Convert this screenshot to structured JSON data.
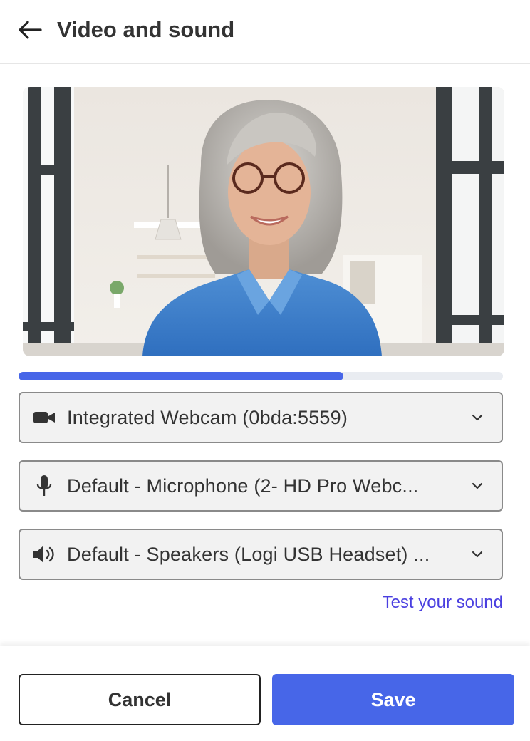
{
  "header": {
    "title": "Video and sound",
    "back_icon": "arrow-left-icon"
  },
  "preview": {
    "description_icon": "camera-preview"
  },
  "audio_level": {
    "fraction": 0.67,
    "color": "#4766e8"
  },
  "devices": {
    "camera": {
      "icon": "video-camera-icon",
      "selected": "Integrated Webcam (0bda:5559)"
    },
    "microphone": {
      "icon": "microphone-icon",
      "selected": "Default - Microphone (2- HD Pro Webc..."
    },
    "speaker": {
      "icon": "speaker-icon",
      "selected": "Default - Speakers (Logi USB Headset) ..."
    }
  },
  "test_sound_label": "Test your sound",
  "footer": {
    "cancel_label": "Cancel",
    "save_label": "Save"
  },
  "colors": {
    "accent": "#4766e8",
    "link": "#4a3fe0"
  }
}
